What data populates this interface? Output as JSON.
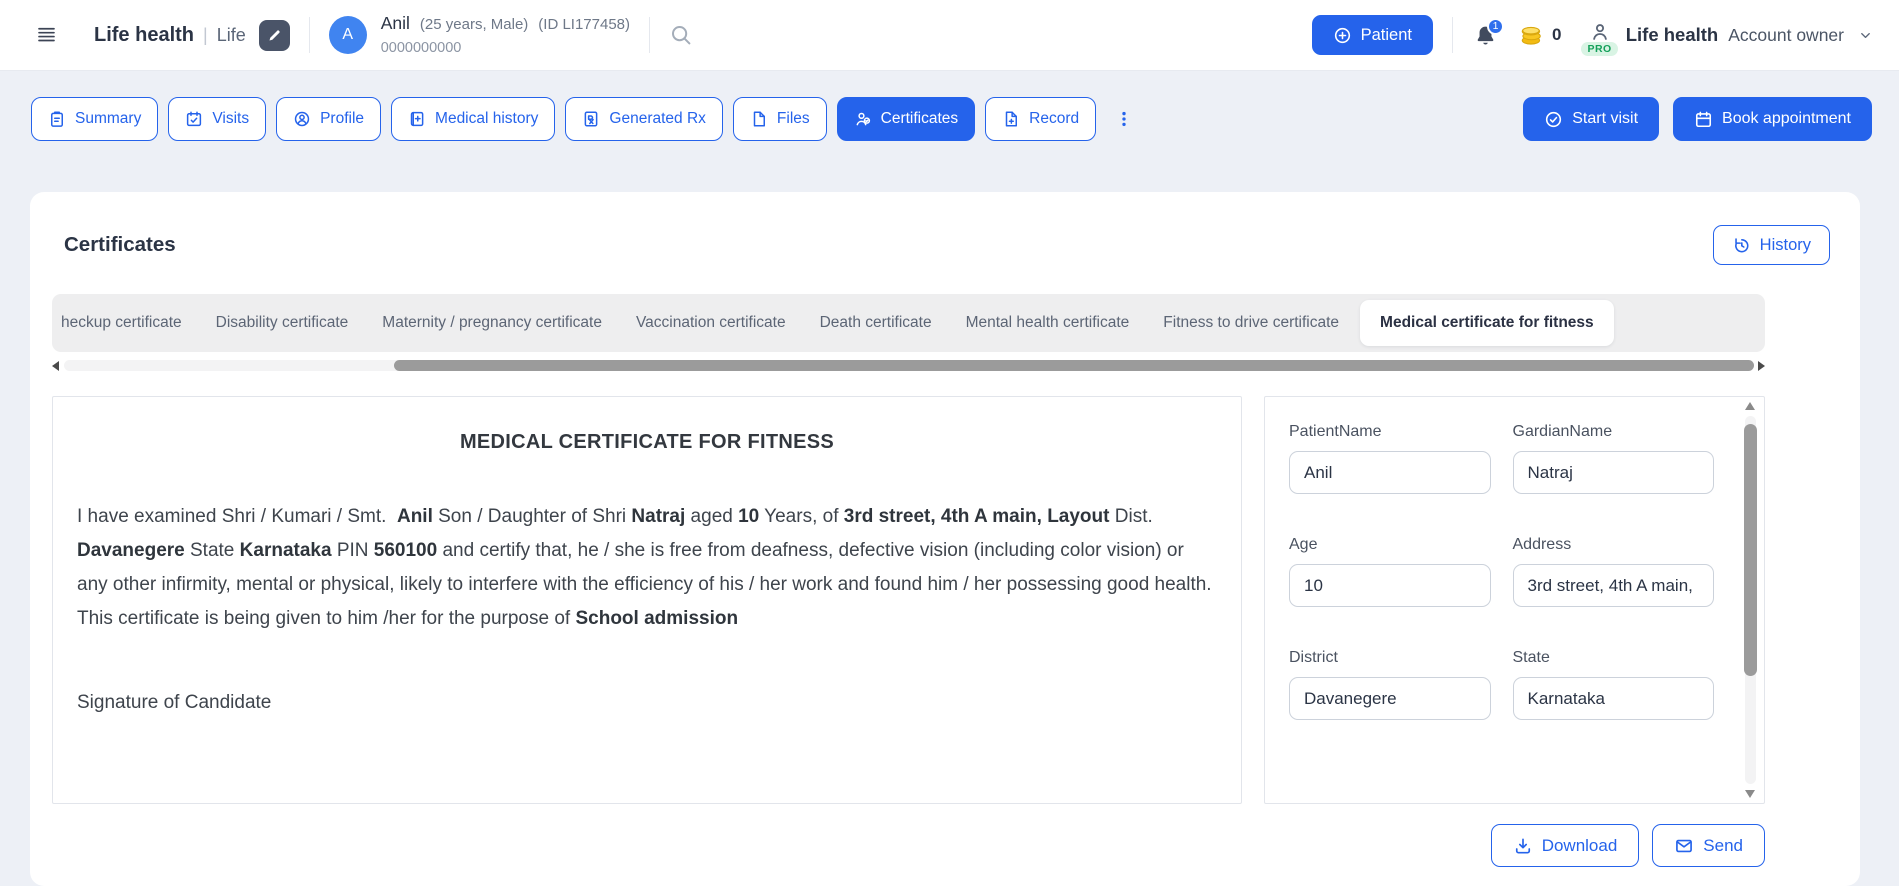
{
  "colors": {
    "primary": "#2563eb",
    "page-bg": "#edf0f6",
    "header-bg": "#ffffff",
    "strip-bg": "#eeeeef",
    "dark-icon": "#414b5e",
    "scroll-thumb": "#9b9b9b",
    "badge-green-bg": "#d9f4e4",
    "badge-green-text": "#14a05a",
    "coin-yellow": "#f8c722"
  },
  "header": {
    "clinic_name": "Life health",
    "clinic_divider": "|",
    "clinic_sub": "Life",
    "avatar_letter": "A",
    "patient_name": "Anil",
    "patient_meta": "(25 years, Male)",
    "patient_id": "(ID LI177458)",
    "patient_phone": "0000000000",
    "add_patient_label": "Patient",
    "notification_count": "1",
    "coins_count": "0",
    "pro_badge": "PRO",
    "account_name": "Life health",
    "account_role": "Account owner",
    "icons": [
      "hamburger-icon",
      "pencil-icon",
      "search-icon",
      "plus-circle-icon",
      "bell-icon",
      "coins-icon",
      "person-icon",
      "chevron-down-icon"
    ]
  },
  "patient_tabs": {
    "items": [
      {
        "label": "Summary",
        "icon": "clipboard-icon",
        "active": false
      },
      {
        "label": "Visits",
        "icon": "calendar-check-icon",
        "active": false
      },
      {
        "label": "Profile",
        "icon": "person-circle-icon",
        "active": false
      },
      {
        "label": "Medical history",
        "icon": "medical-history-icon",
        "active": false
      },
      {
        "label": "Generated Rx",
        "icon": "rx-icon",
        "active": false
      },
      {
        "label": "Files",
        "icon": "file-icon",
        "active": false
      },
      {
        "label": "Certificates",
        "icon": "certificate-icon",
        "active": true
      },
      {
        "label": "Record",
        "icon": "file-plus-icon",
        "active": false
      }
    ],
    "start_visit": "Start visit",
    "book_appointment": "Book appointment"
  },
  "certificates": {
    "title": "Certificates",
    "history_button": "History",
    "tabs": [
      {
        "label": "heckup certificate",
        "active": false,
        "clipped": true
      },
      {
        "label": "Disability certificate",
        "active": false
      },
      {
        "label": "Maternity / pregnancy certificate",
        "active": false
      },
      {
        "label": "Vaccination certificate",
        "active": false
      },
      {
        "label": "Death certificate",
        "active": false
      },
      {
        "label": "Mental health certificate",
        "active": false
      },
      {
        "label": "Fitness to drive certificate",
        "active": false
      },
      {
        "label": "Medical certificate for fitness",
        "active": true
      }
    ],
    "preview": {
      "title": "MEDICAL CERTIFICATE FOR FITNESS",
      "body": [
        {
          "text": "I have examined Shri / Kumari / Smt.  ",
          "bold": false
        },
        {
          "text": "Anil",
          "bold": true
        },
        {
          "text": " Son / Daughter of Shri ",
          "bold": false
        },
        {
          "text": "Natraj",
          "bold": true
        },
        {
          "text": " aged ",
          "bold": false
        },
        {
          "text": "10",
          "bold": true
        },
        {
          "text": " Years, of ",
          "bold": false
        },
        {
          "text": "3rd street, 4th A main, Layout",
          "bold": true
        },
        {
          "text": " Dist. ",
          "bold": false
        },
        {
          "text": "Davanegere",
          "bold": true
        },
        {
          "text": " State ",
          "bold": false
        },
        {
          "text": "Karnataka",
          "bold": true
        },
        {
          "text": " PIN ",
          "bold": false
        },
        {
          "text": "560100",
          "bold": true
        },
        {
          "text": " and certify that, he / she is free from deafness, defective vision (including color vision) or any other infirmity, mental or physical, likely to interfere with the efficiency of his / her work and found him / her possessing good health. This certificate is being given to him /her for the purpose of ",
          "bold": false
        },
        {
          "text": "School admission",
          "bold": true
        }
      ],
      "signature": "Signature of Candidate"
    },
    "form": {
      "fields": [
        {
          "label": "PatientName",
          "value": "Anil"
        },
        {
          "label": "GardianName",
          "value": "Natraj"
        },
        {
          "label": "Age",
          "value": "10"
        },
        {
          "label": "Address",
          "value": "3rd street, 4th A main,"
        },
        {
          "label": "District",
          "value": "Davanegere"
        },
        {
          "label": "State",
          "value": "Karnataka"
        }
      ]
    },
    "download_button": "Download",
    "send_button": "Send"
  }
}
